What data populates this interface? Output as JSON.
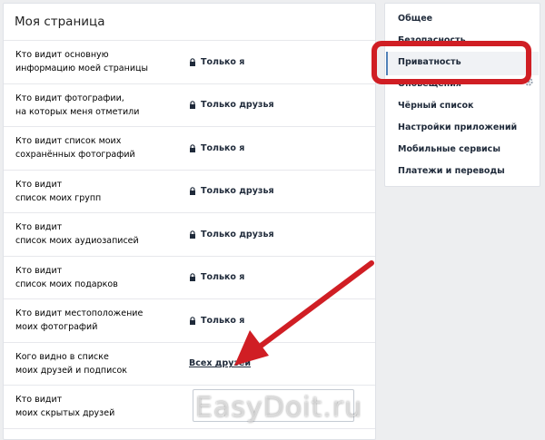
{
  "header": {
    "title": "Моя страница"
  },
  "rows": [
    {
      "label": "Кто видит основную\nинформацию моей страницы",
      "value": "Только я"
    },
    {
      "label": "Кто видит фотографии,\nна которых меня отметили",
      "value": "Только друзья"
    },
    {
      "label": "Кто видит список моих\nсохранённых фотографий",
      "value": "Только я"
    },
    {
      "label": "Кто видит\nсписок моих групп",
      "value": "Только друзья"
    },
    {
      "label": "Кто видит\nсписок моих аудиозаписей",
      "value": "Только друзья"
    },
    {
      "label": "Кто видит\nсписок моих подарков",
      "value": "Только я"
    },
    {
      "label": "Кто видит местоположение\nмоих фотографий",
      "value": "Только я"
    },
    {
      "label": "Кого видно в списке\nмоих друзей и подписок",
      "value": "Всех друзей"
    },
    {
      "label": "Кто видит\nмоих скрытых друзей",
      "value": ""
    }
  ],
  "sidebar": {
    "items": [
      {
        "label": "Общее"
      },
      {
        "label": "Безопасность"
      },
      {
        "label": "Приватность"
      },
      {
        "label": "Оповещения"
      },
      {
        "label": "Чёрный список"
      },
      {
        "label": "Настройки приложений"
      },
      {
        "label": "Мобильные сервисы"
      },
      {
        "label": "Платежи и переводы"
      }
    ],
    "active": "Приватность"
  },
  "watermark": "EasyDoit.ru",
  "colors": {
    "highlight": "#d01e24",
    "text_dark": "#1f2a3a",
    "accent": "#5181b8"
  }
}
